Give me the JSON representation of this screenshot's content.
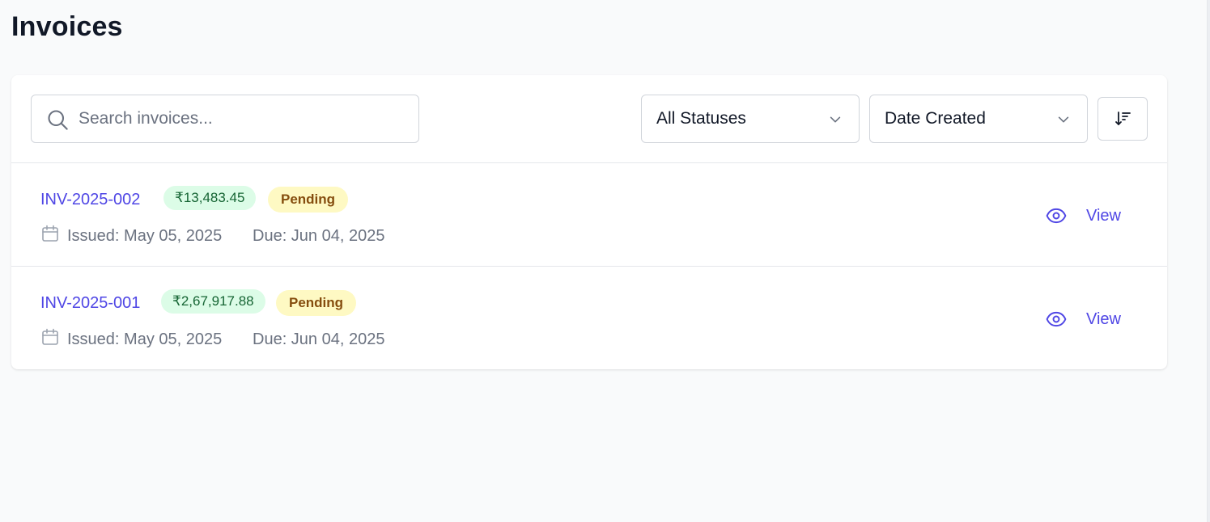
{
  "page": {
    "title": "Invoices"
  },
  "toolbar": {
    "search": {
      "placeholder": "Search invoices...",
      "value": "",
      "icon": "search-icon"
    },
    "status_filter": {
      "selected": "All Statuses",
      "icon": "chevron-down-icon"
    },
    "sort_by": {
      "selected": "Date Created",
      "icon": "chevron-down-icon"
    },
    "sort_direction": {
      "icon": "sort-descending-icon"
    }
  },
  "invoices": [
    {
      "number": "INV-2025-002",
      "amount": "₹13,483.45",
      "status": "Pending",
      "issued": "Issued: May 05, 2025",
      "due": "Due: Jun 04, 2025",
      "action": "View"
    },
    {
      "number": "INV-2025-001",
      "amount": "₹2,67,917.88",
      "status": "Pending",
      "issued": "Issued: May 05, 2025",
      "due": "Due: Jun 04, 2025",
      "action": "View"
    }
  ],
  "colors": {
    "link": "#4f46e5",
    "amount_bg": "#dcfce7",
    "amount_text": "#166534",
    "pending_bg": "#fef9c3",
    "pending_text": "#854d0e",
    "background": "#f9fafb"
  }
}
